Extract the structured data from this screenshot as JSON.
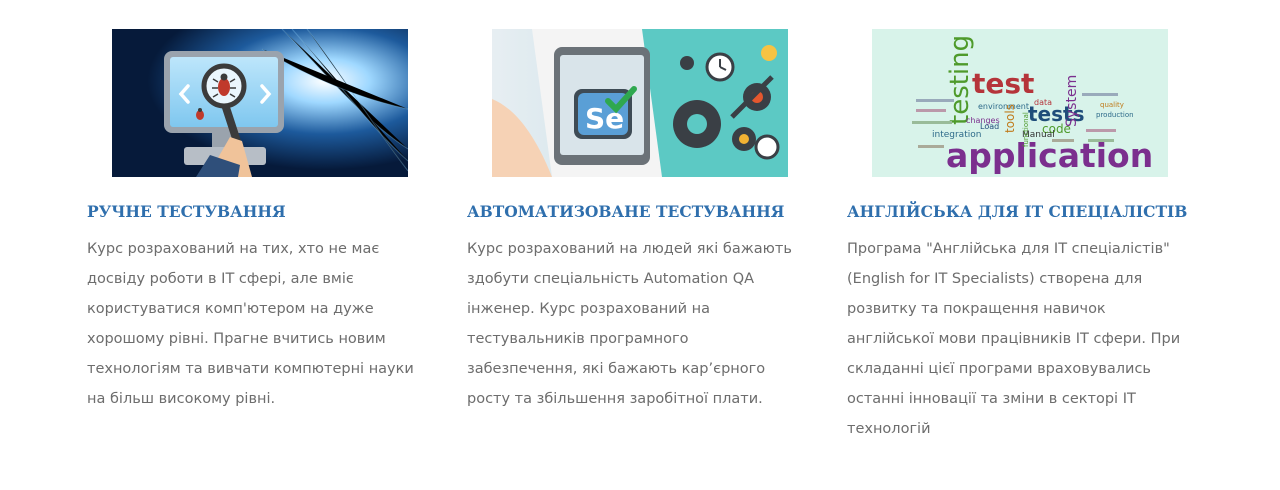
{
  "courses": [
    {
      "image_icon": "manual-testing-bug-magnifier",
      "title": "РУЧНЕ ТЕСТУВАННЯ",
      "description": "Курс розрахований на тих, хто не має досвіду роботи в IT сфері, але вміє користуватися комп'ютером на дуже хорошому рівні. Прагне вчитись новим технологіям та вивчати компютерні науки на більш високому рівні."
    },
    {
      "image_icon": "automation-testing-selenium-gears",
      "image_text": "Se",
      "title": "АВТОМАТИЗОВАНЕ ТЕСТУВАННЯ",
      "description": "Курс розрахований на людей які бажають здобути спеціальність Automation QA інженер. Курс розрахований на тестувальників програмного забезпечення, які бажають кар’єрного росту та збільшення заробітної плати."
    },
    {
      "image_icon": "english-it-word-cloud",
      "image_words": {
        "w1": "testing",
        "w2": "test",
        "w3": "application",
        "w4": "tests",
        "w5": "System",
        "w6": "environment",
        "w7": "tools",
        "w8": "code",
        "w9": "Manual",
        "w10": "integration",
        "w11": "changes",
        "w12": "data",
        "w13": "functional",
        "w14": "production",
        "w15": "quality",
        "w16": "Load"
      },
      "title": "АНГЛІЙСЬКА ДЛЯ IT СПЕЦІАЛІСТІВ",
      "description": "Програма \"Англійська для IT спеціалістів\" (English for IT Specialists) створена для розвитку та покращення навичок англійської мови працівників IT сфери. При складанні цієї програми враховувались останні інновації та зміни в секторі IT технологій"
    }
  ],
  "colors": {
    "title": "#2f6fad",
    "text": "#6d6d6d"
  }
}
